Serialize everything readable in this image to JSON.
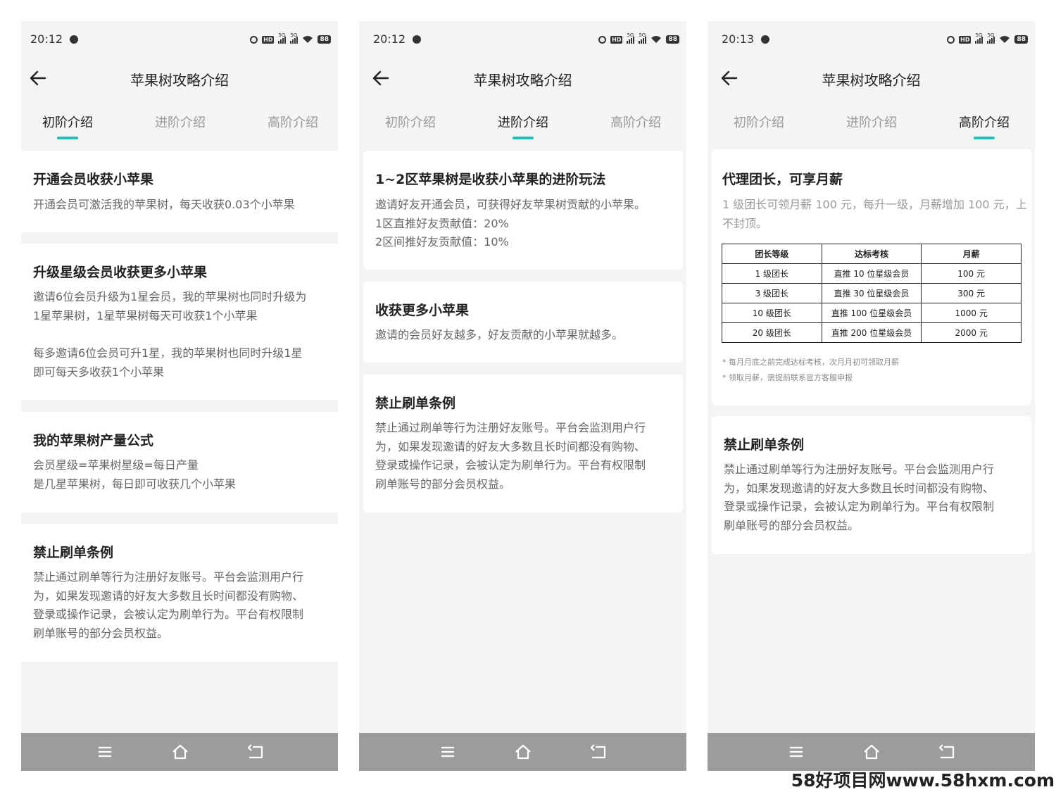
{
  "screens": [
    {
      "status": {
        "time": "20:12",
        "battery": "88",
        "net": "5G"
      },
      "title": "苹果树攻略介绍",
      "tabs": [
        "初阶介绍",
        "进阶介绍",
        "高阶介绍"
      ],
      "active_tab": 0,
      "cards": [
        {
          "title": "开通会员收获小苹果",
          "lines": [
            "开通会员可激活我的苹果树，每天收获0.03个小苹果"
          ]
        },
        {
          "title": "升级星级会员收获更多小苹果",
          "lines": [
            "邀请6位会员升级为1星会员，我的苹果树也同时升级为",
            "1星苹果树，1星苹果树每天可收获1个小苹果",
            "",
            "每多邀请6位会员可升1星，我的苹果树也同时升级1星",
            "即可每天多收获1个小苹果"
          ]
        },
        {
          "title": "我的苹果树产量公式",
          "lines": [
            "会员星级=苹果树星级=每日产量",
            "是几星苹果树，每日即可收获几个小苹果"
          ]
        },
        {
          "title": "禁止刷单条例",
          "lines": [
            "禁止通过刷单等行为注册好友账号。平台会监测用户行",
            "为，如果发现邀请的好友大多数且长时间都没有购物、",
            "登录或操作记录，会被认定为刷单行为。平台有权限制",
            "刷单账号的部分会员权益。"
          ]
        }
      ]
    },
    {
      "status": {
        "time": "20:12",
        "battery": "88",
        "net": "5G"
      },
      "title": "苹果树攻略介绍",
      "tabs": [
        "初阶介绍",
        "进阶介绍",
        "高阶介绍"
      ],
      "active_tab": 1,
      "cards": [
        {
          "title": "1~2区苹果树是收获小苹果的进阶玩法",
          "lines": [
            "邀请好友开通会员，可获得好友苹果树贡献的小苹果。",
            "1区直推好友贡献值：20%",
            "2区间推好友贡献值：10%"
          ]
        },
        {
          "title": "收获更多小苹果",
          "lines": [
            "邀请的会员好友越多，好友贡献的小苹果就越多。"
          ]
        },
        {
          "title": "禁止刷单条例",
          "lines": [
            "禁止通过刷单等行为注册好友账号。平台会监测用户行",
            "为，如果发现邀请的好友大多数且长时间都没有购物、",
            "登录或操作记录，会被认定为刷单行为。平台有权限制",
            "刷单账号的部分会员权益。"
          ]
        }
      ]
    },
    {
      "status": {
        "time": "20:13",
        "battery": "88",
        "net": "5G"
      },
      "title": "苹果树攻略介绍",
      "tabs": [
        "初阶介绍",
        "进阶介绍",
        "高阶介绍"
      ],
      "active_tab": 2,
      "cards": [
        {
          "title": "代理团长，可享月薪",
          "lines": [
            "1 级团长可领月薪 100 元，每升一级，月薪增加 100 元，上",
            "不封顶。"
          ]
        },
        {
          "title": "禁止刷单条例",
          "lines": [
            "禁止通过刷单等行为注册好友账号。平台会监测用户行",
            "为，如果发现邀请的好友大多数且长时间都没有购物、",
            "登录或操作记录，会被认定为刷单行为。平台有权限制",
            "刷单账号的部分会员权益。"
          ]
        }
      ],
      "table": {
        "headers": [
          "团长等级",
          "达标考核",
          "月薪"
        ],
        "rows": [
          [
            "1 级团长",
            "直推 10 位星级会员",
            "100 元"
          ],
          [
            "3 级团长",
            "直推 30 位星级会员",
            "300 元"
          ],
          [
            "10 级团长",
            "直推 100 位星级会员",
            "1000 元"
          ],
          [
            "20 级团长",
            "直推 200 位星级会员",
            "2000 元"
          ]
        ],
        "notes": [
          "* 每月月底之前完成达标考核，次月月初可领取月薪",
          "* 领取月薪，需提前联系官方客服申报"
        ]
      }
    }
  ],
  "watermark": "58好项目网www.58hxm.com",
  "colors": {
    "accent": "#1fbfb8",
    "page_bg": "#f4f4f4",
    "card_bg": "#ffffff",
    "nav_bar": "#9c9c9c"
  }
}
